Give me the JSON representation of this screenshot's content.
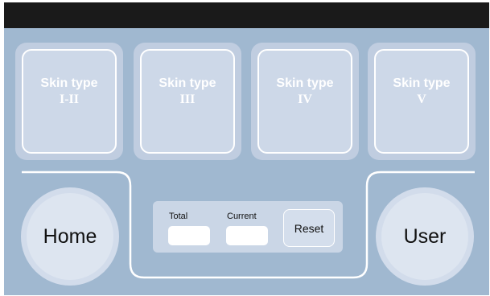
{
  "skin_types": [
    {
      "line1": "Skin type",
      "line2": "I-II"
    },
    {
      "line1": "Skin type",
      "line2": "III"
    },
    {
      "line1": "Skin type",
      "line2": "IV"
    },
    {
      "line1": "Skin type",
      "line2": "V"
    }
  ],
  "home": {
    "label": "Home"
  },
  "user": {
    "label": "User"
  },
  "counter": {
    "total_label": "Total",
    "total_value": "",
    "current_label": "Current",
    "current_value": "",
    "reset_label": "Reset"
  },
  "colors": {
    "background": "#a0b8d0",
    "tile": "#c0cde0",
    "top_bar": "#1a1a1a"
  }
}
